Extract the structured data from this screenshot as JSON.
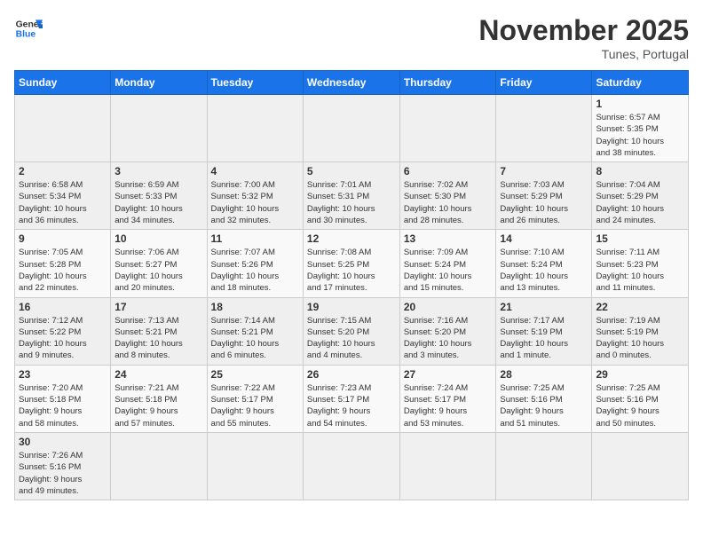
{
  "logo": {
    "general": "General",
    "blue": "Blue"
  },
  "header": {
    "month": "November 2025",
    "location": "Tunes, Portugal"
  },
  "weekdays": [
    "Sunday",
    "Monday",
    "Tuesday",
    "Wednesday",
    "Thursday",
    "Friday",
    "Saturday"
  ],
  "weeks": [
    [
      {
        "day": "",
        "info": ""
      },
      {
        "day": "",
        "info": ""
      },
      {
        "day": "",
        "info": ""
      },
      {
        "day": "",
        "info": ""
      },
      {
        "day": "",
        "info": ""
      },
      {
        "day": "",
        "info": ""
      },
      {
        "day": "1",
        "info": "Sunrise: 6:57 AM\nSunset: 5:35 PM\nDaylight: 10 hours\nand 38 minutes."
      }
    ],
    [
      {
        "day": "2",
        "info": "Sunrise: 6:58 AM\nSunset: 5:34 PM\nDaylight: 10 hours\nand 36 minutes."
      },
      {
        "day": "3",
        "info": "Sunrise: 6:59 AM\nSunset: 5:33 PM\nDaylight: 10 hours\nand 34 minutes."
      },
      {
        "day": "4",
        "info": "Sunrise: 7:00 AM\nSunset: 5:32 PM\nDaylight: 10 hours\nand 32 minutes."
      },
      {
        "day": "5",
        "info": "Sunrise: 7:01 AM\nSunset: 5:31 PM\nDaylight: 10 hours\nand 30 minutes."
      },
      {
        "day": "6",
        "info": "Sunrise: 7:02 AM\nSunset: 5:30 PM\nDaylight: 10 hours\nand 28 minutes."
      },
      {
        "day": "7",
        "info": "Sunrise: 7:03 AM\nSunset: 5:29 PM\nDaylight: 10 hours\nand 26 minutes."
      },
      {
        "day": "8",
        "info": "Sunrise: 7:04 AM\nSunset: 5:29 PM\nDaylight: 10 hours\nand 24 minutes."
      }
    ],
    [
      {
        "day": "9",
        "info": "Sunrise: 7:05 AM\nSunset: 5:28 PM\nDaylight: 10 hours\nand 22 minutes."
      },
      {
        "day": "10",
        "info": "Sunrise: 7:06 AM\nSunset: 5:27 PM\nDaylight: 10 hours\nand 20 minutes."
      },
      {
        "day": "11",
        "info": "Sunrise: 7:07 AM\nSunset: 5:26 PM\nDaylight: 10 hours\nand 18 minutes."
      },
      {
        "day": "12",
        "info": "Sunrise: 7:08 AM\nSunset: 5:25 PM\nDaylight: 10 hours\nand 17 minutes."
      },
      {
        "day": "13",
        "info": "Sunrise: 7:09 AM\nSunset: 5:24 PM\nDaylight: 10 hours\nand 15 minutes."
      },
      {
        "day": "14",
        "info": "Sunrise: 7:10 AM\nSunset: 5:24 PM\nDaylight: 10 hours\nand 13 minutes."
      },
      {
        "day": "15",
        "info": "Sunrise: 7:11 AM\nSunset: 5:23 PM\nDaylight: 10 hours\nand 11 minutes."
      }
    ],
    [
      {
        "day": "16",
        "info": "Sunrise: 7:12 AM\nSunset: 5:22 PM\nDaylight: 10 hours\nand 9 minutes."
      },
      {
        "day": "17",
        "info": "Sunrise: 7:13 AM\nSunset: 5:21 PM\nDaylight: 10 hours\nand 8 minutes."
      },
      {
        "day": "18",
        "info": "Sunrise: 7:14 AM\nSunset: 5:21 PM\nDaylight: 10 hours\nand 6 minutes."
      },
      {
        "day": "19",
        "info": "Sunrise: 7:15 AM\nSunset: 5:20 PM\nDaylight: 10 hours\nand 4 minutes."
      },
      {
        "day": "20",
        "info": "Sunrise: 7:16 AM\nSunset: 5:20 PM\nDaylight: 10 hours\nand 3 minutes."
      },
      {
        "day": "21",
        "info": "Sunrise: 7:17 AM\nSunset: 5:19 PM\nDaylight: 10 hours\nand 1 minute."
      },
      {
        "day": "22",
        "info": "Sunrise: 7:19 AM\nSunset: 5:19 PM\nDaylight: 10 hours\nand 0 minutes."
      }
    ],
    [
      {
        "day": "23",
        "info": "Sunrise: 7:20 AM\nSunset: 5:18 PM\nDaylight: 9 hours\nand 58 minutes."
      },
      {
        "day": "24",
        "info": "Sunrise: 7:21 AM\nSunset: 5:18 PM\nDaylight: 9 hours\nand 57 minutes."
      },
      {
        "day": "25",
        "info": "Sunrise: 7:22 AM\nSunset: 5:17 PM\nDaylight: 9 hours\nand 55 minutes."
      },
      {
        "day": "26",
        "info": "Sunrise: 7:23 AM\nSunset: 5:17 PM\nDaylight: 9 hours\nand 54 minutes."
      },
      {
        "day": "27",
        "info": "Sunrise: 7:24 AM\nSunset: 5:17 PM\nDaylight: 9 hours\nand 53 minutes."
      },
      {
        "day": "28",
        "info": "Sunrise: 7:25 AM\nSunset: 5:16 PM\nDaylight: 9 hours\nand 51 minutes."
      },
      {
        "day": "29",
        "info": "Sunrise: 7:25 AM\nSunset: 5:16 PM\nDaylight: 9 hours\nand 50 minutes."
      }
    ],
    [
      {
        "day": "30",
        "info": "Sunrise: 7:26 AM\nSunset: 5:16 PM\nDaylight: 9 hours\nand 49 minutes."
      },
      {
        "day": "",
        "info": ""
      },
      {
        "day": "",
        "info": ""
      },
      {
        "day": "",
        "info": ""
      },
      {
        "day": "",
        "info": ""
      },
      {
        "day": "",
        "info": ""
      },
      {
        "day": "",
        "info": ""
      }
    ]
  ]
}
